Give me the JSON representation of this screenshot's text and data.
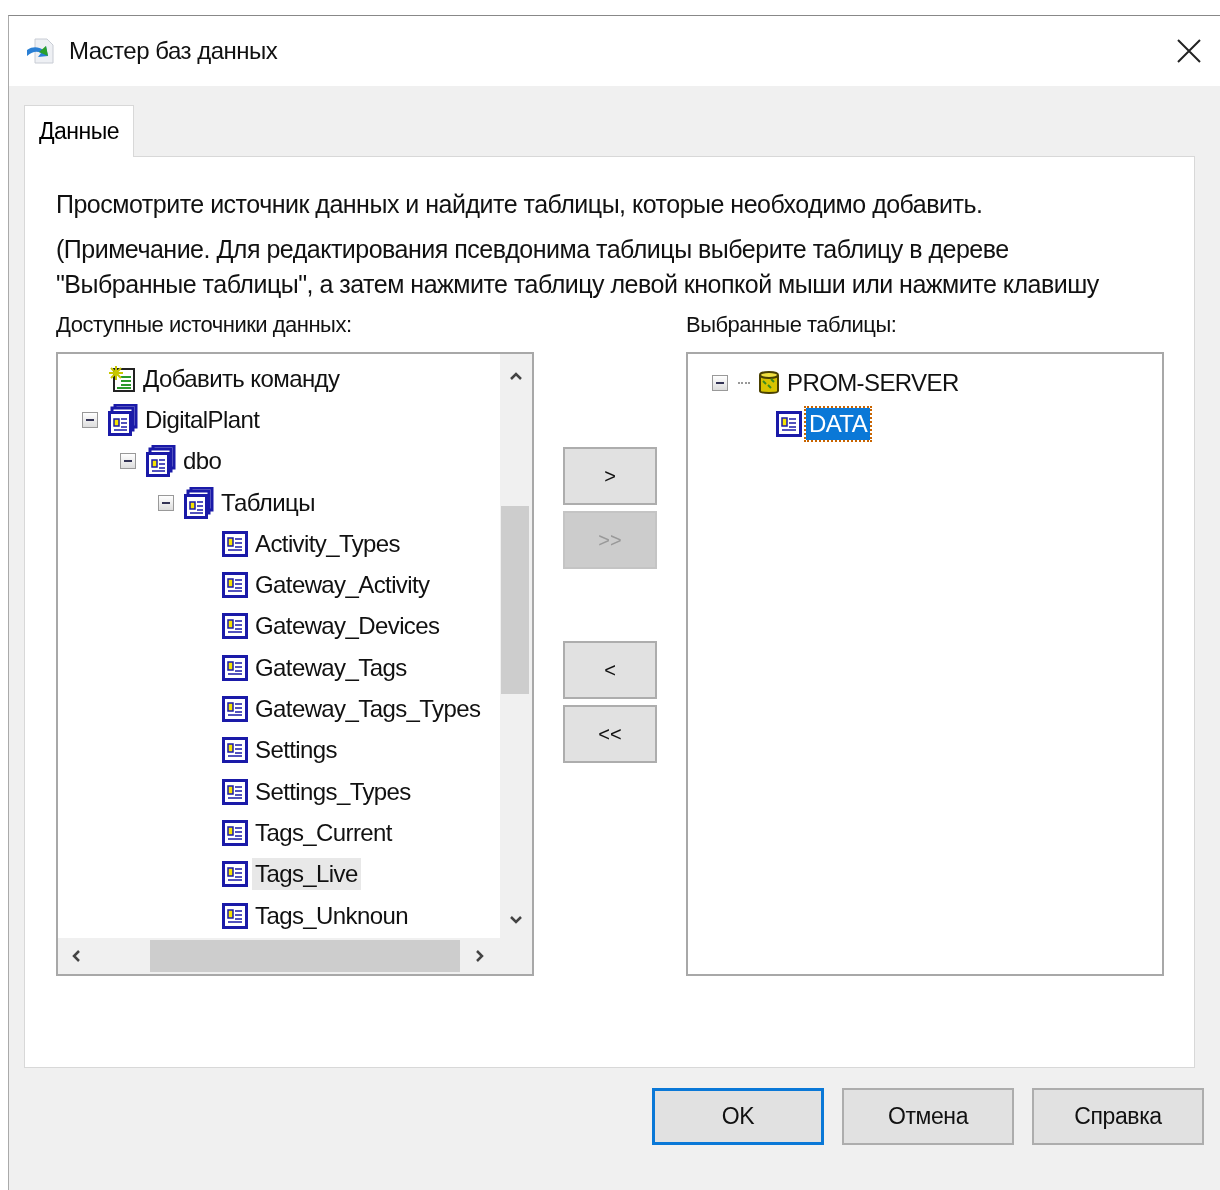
{
  "window": {
    "title": "Мастер баз данных"
  },
  "tabs": [
    {
      "label": "Данные",
      "selected": true
    }
  ],
  "instructions": [
    "Просмотрите источник данных и найдите таблицы, которые необходимо добавить.",
    "(Примечание. Для редактирования псевдонима таблицы выберите таблицу в дереве \"Выбранные таблицы\", а затем нажмите таблицу левой кнопкой мыши или нажмите клавишу"
  ],
  "available_sources": {
    "label": "Доступные источники данных:",
    "items": [
      {
        "kind": "command",
        "label": "Добавить команду",
        "selected": false,
        "hovered": false
      },
      {
        "kind": "folder",
        "label": "DigitalPlant",
        "expanded": true,
        "selected": false,
        "hovered": false,
        "children": [
          {
            "kind": "folder",
            "label": "dbo",
            "expanded": true,
            "selected": false,
            "hovered": false,
            "children": [
              {
                "kind": "folder",
                "label": "Таблицы",
                "expanded": true,
                "selected": false,
                "hovered": false,
                "children": [
                  {
                    "kind": "table",
                    "label": "Activity_Types",
                    "selected": false,
                    "hovered": false
                  },
                  {
                    "kind": "table",
                    "label": "Gateway_Activity",
                    "selected": false,
                    "hovered": false
                  },
                  {
                    "kind": "table",
                    "label": "Gateway_Devices",
                    "selected": false,
                    "hovered": false
                  },
                  {
                    "kind": "table",
                    "label": "Gateway_Tags",
                    "selected": false,
                    "hovered": false
                  },
                  {
                    "kind": "table",
                    "label": "Gateway_Tags_Types",
                    "selected": false,
                    "hovered": false
                  },
                  {
                    "kind": "table",
                    "label": "Settings",
                    "selected": false,
                    "hovered": false
                  },
                  {
                    "kind": "table",
                    "label": "Settings_Types",
                    "selected": false,
                    "hovered": false
                  },
                  {
                    "kind": "table",
                    "label": "Tags_Current",
                    "selected": false,
                    "hovered": false
                  },
                  {
                    "kind": "table",
                    "label": "Tags_Live",
                    "selected": false,
                    "hovered": true
                  },
                  {
                    "kind": "table",
                    "label": "Tags_Unknoun",
                    "selected": false,
                    "hovered": false
                  }
                ]
              }
            ]
          }
        ]
      }
    ]
  },
  "move_buttons": [
    {
      "label": ">",
      "disabled": false
    },
    {
      "label": ">>",
      "disabled": true
    },
    {
      "label": "<",
      "disabled": false
    },
    {
      "label": "<<",
      "disabled": false
    }
  ],
  "selected_tables": {
    "label": "Выбранные таблицы:",
    "items": [
      {
        "kind": "server",
        "label": "PROM-SERVER",
        "expanded": true,
        "selected": false,
        "hovered": false,
        "children": [
          {
            "kind": "table",
            "label": "DATA",
            "selected": true,
            "hovered": false
          }
        ]
      }
    ]
  },
  "buttons": [
    {
      "label": "OK",
      "default": true
    },
    {
      "label": "Отмена",
      "default": false
    },
    {
      "label": "Справка",
      "default": false
    }
  ]
}
